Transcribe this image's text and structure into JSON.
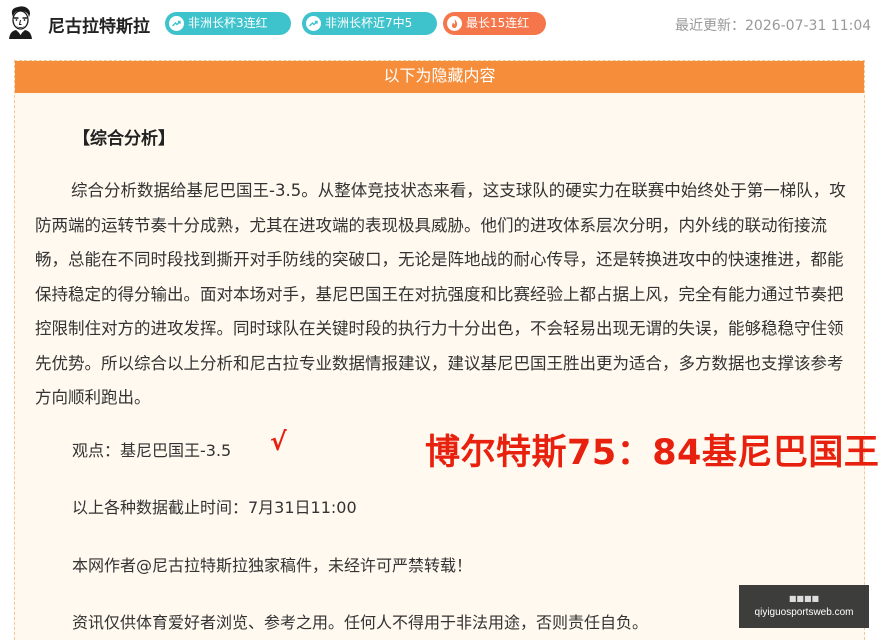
{
  "header": {
    "avatar_icon": "portrait-icon",
    "author_name": "尼古拉特斯拉",
    "badges": [
      {
        "label": "非洲长杯3连红",
        "icon": "trend-up-icon",
        "color": "#3ec3cc"
      },
      {
        "label": "非洲长杯近7中5",
        "icon": "trend-up-icon",
        "color": "#3ec3cc"
      },
      {
        "label": "最长15连红",
        "icon": "flame-icon",
        "color": "#f5764a"
      }
    ],
    "last_updated": "最近更新：2026-07-31 11:04"
  },
  "hidden_section": {
    "banner": "以下为隐藏内容",
    "banner_color": "#f58d3a",
    "heading": "【综合分析】",
    "paragraph": "综合分析数据给基尼巴国王-3.5。从整体竞技状态来看，这支球队的硬实力在联赛中始终处于第一梯队，攻防两端的运转节奏十分成熟，尤其在进攻端的表现极具威胁。他们的进攻体系层次分明，内外线的联动衔接流畅，总能在不同时段找到撕开对手防线的突破口，无论是阵地战的耐心传导，还是转换进攻中的快速推进，都能保持稳定的得分输出。面对本场对手，基尼巴国王在对抗强度和比赛经验上都占据上风，完全有能力通过节奏把控限制住对方的进攻发挥。同时球队在关键时段的执行力十分出色，不会轻易出现无谓的失误，能够稳稳守住领先优势。所以综合以上分析和尼古拉专业数据情报建议，建议基尼巴国王胜出更为适合，多方数据也支撑该参考方向顺利跑出。",
    "viewpoint": "观点：基尼巴国王-3.5",
    "check_mark": "√",
    "score": "博尔特斯75：84基尼巴国王",
    "result_color": "#e8200e",
    "cutoff": "以上各种数据截止时间：7月31日11:00",
    "copyright": "本网作者@尼古拉特斯拉独家稿件，未经许可严禁转载！",
    "disclaimer": "资讯仅供体育爱好者浏览、参考之用。任何人不得用于非法用途，否则责任自负。"
  },
  "watermark": {
    "title": "■■■■",
    "url": "qiyiguosportsweb.com"
  }
}
